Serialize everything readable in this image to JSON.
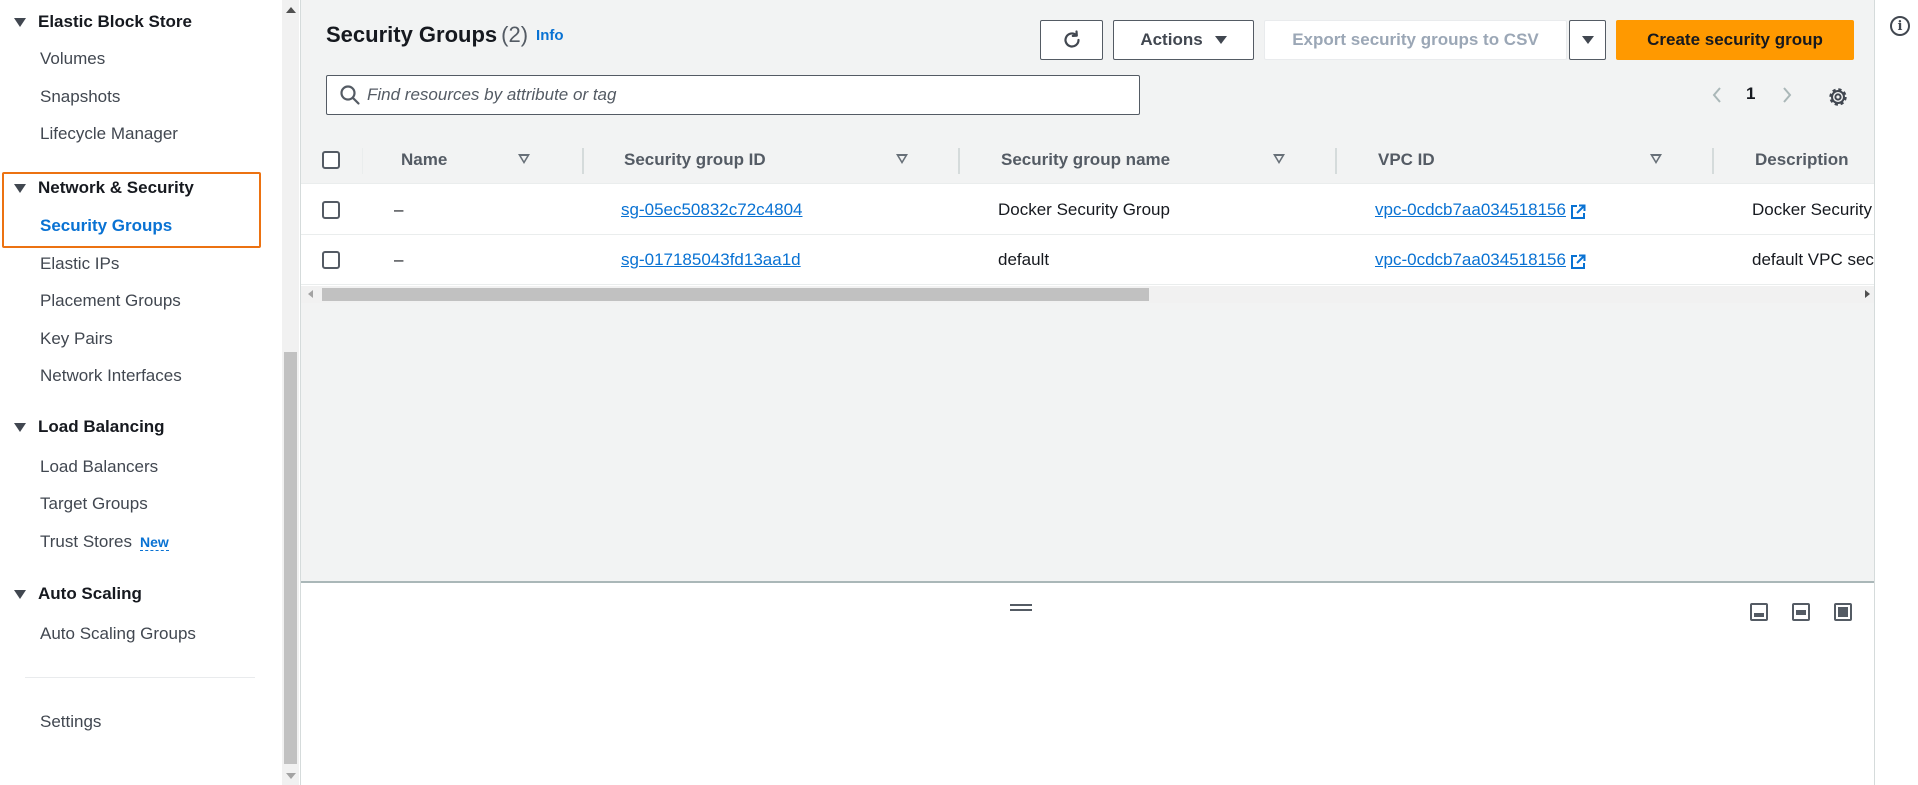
{
  "sidebar": {
    "sections": [
      {
        "title": "Elastic Block Store",
        "items": [
          "Volumes",
          "Snapshots",
          "Lifecycle Manager"
        ]
      },
      {
        "title": "Network & Security",
        "items": [
          "Security Groups",
          "Elastic IPs",
          "Placement Groups",
          "Key Pairs",
          "Network Interfaces"
        ]
      },
      {
        "title": "Load Balancing",
        "items": [
          "Load Balancers",
          "Target Groups",
          "Trust Stores"
        ]
      },
      {
        "title": "Auto Scaling",
        "items": [
          "Auto Scaling Groups"
        ]
      }
    ],
    "new_badge": "New",
    "settings": "Settings",
    "active_item": "Security Groups"
  },
  "header": {
    "title": "Security Groups",
    "count": "(2)",
    "info": "Info"
  },
  "toolbar": {
    "actions_label": "Actions",
    "export_label": "Export security groups to CSV",
    "create_label": "Create security group"
  },
  "search": {
    "placeholder": "Find resources by attribute or tag"
  },
  "pagination": {
    "current_page": "1"
  },
  "table": {
    "columns": [
      "Name",
      "Security group ID",
      "Security group name",
      "VPC ID",
      "Description"
    ],
    "rows": [
      {
        "name": "–",
        "sg_id": "sg-05ec50832c72c4804",
        "sg_name": "Docker Security Group",
        "vpc_id": "vpc-0cdcb7aa034518156",
        "description": "Docker Security"
      },
      {
        "name": "–",
        "sg_id": "sg-017185043fd13aa1d",
        "sg_name": "default",
        "vpc_id": "vpc-0cdcb7aa034518156",
        "description": "default VPC secu"
      }
    ]
  },
  "colors": {
    "accent_orange": "#ff9900",
    "highlight_orange": "#ec7211",
    "link_blue": "#0972d3"
  }
}
